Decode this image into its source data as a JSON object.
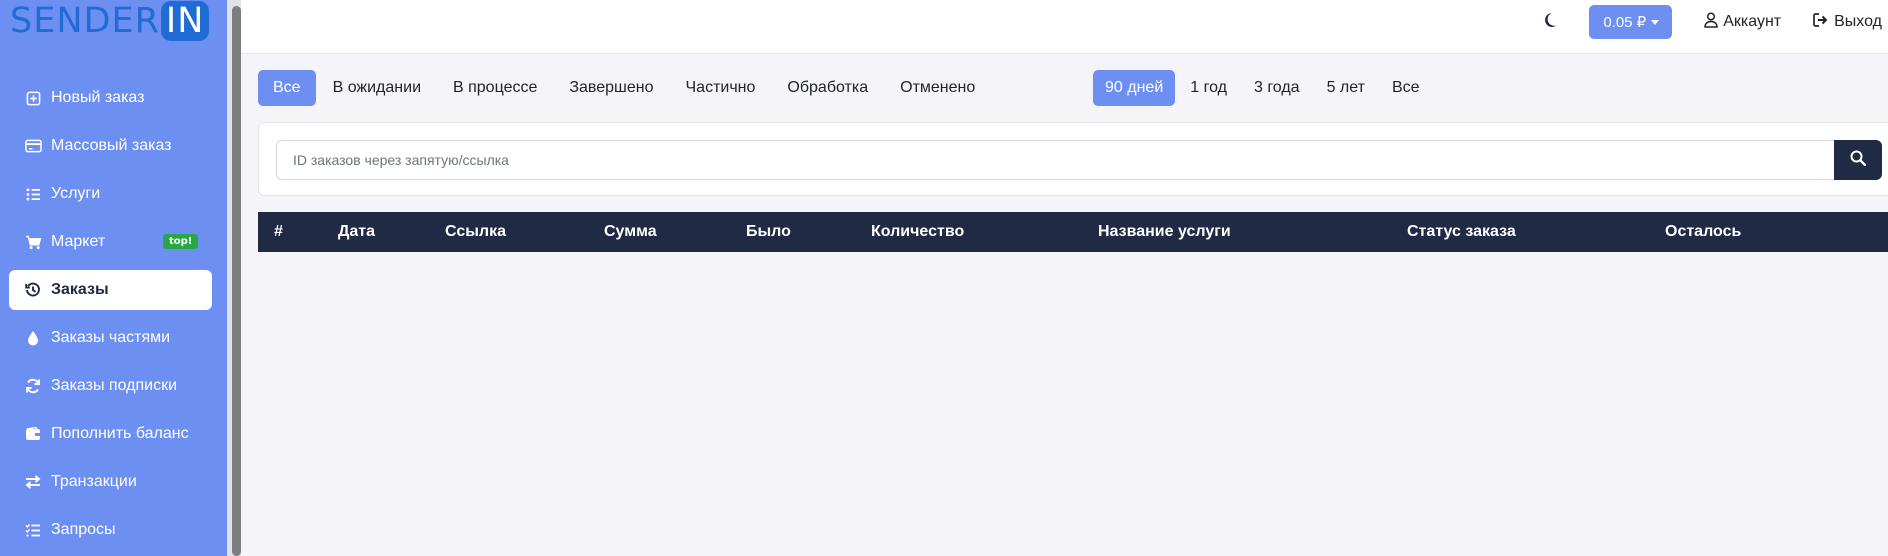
{
  "logo": {
    "text": "SENDER",
    "box": "IN"
  },
  "colors": {
    "sidebar": "#6d8ff2",
    "accent": "#6d8ff2",
    "dark": "#212a45",
    "badge": "#28a745",
    "logo": "#1f6cd4"
  },
  "sidebar": {
    "items": [
      {
        "label": "Новый заказ",
        "icon": "plus-square-icon"
      },
      {
        "label": "Массовый заказ",
        "icon": "credit-card-icon"
      },
      {
        "label": "Услуги",
        "icon": "list-icon"
      },
      {
        "label": "Маркет",
        "icon": "cart-icon",
        "badge": "top!"
      },
      {
        "label": "Заказы",
        "icon": "history-icon",
        "active": true
      },
      {
        "label": "Заказы частями",
        "icon": "droplet-icon"
      },
      {
        "label": "Заказы подписки",
        "icon": "refresh-icon"
      },
      {
        "label": "Пополнить баланс",
        "icon": "wallet-icon"
      },
      {
        "label": "Транзакции",
        "icon": "exchange-icon"
      },
      {
        "label": "Запросы",
        "icon": "list-check-icon"
      }
    ]
  },
  "header": {
    "balance": "0.05 ₽",
    "account": "Аккаунт",
    "logout": "Выход",
    "theme_icon": "moon-icon"
  },
  "status_filters": [
    "Все",
    "В ожидании",
    "В процессе",
    "Завершено",
    "Частично",
    "Обработка",
    "Отменено"
  ],
  "status_active": "Все",
  "period_filters": [
    "90 дней",
    "1 год",
    "3 года",
    "5 лет",
    "Все"
  ],
  "period_active": "90 дней",
  "search": {
    "placeholder": "ID заказов через запятую/ссылка"
  },
  "table": {
    "columns": [
      "#",
      "Дата",
      "Ссылка",
      "Сумма",
      "Было",
      "Количество",
      "Название услуги",
      "Статус заказа",
      "Осталось"
    ]
  }
}
